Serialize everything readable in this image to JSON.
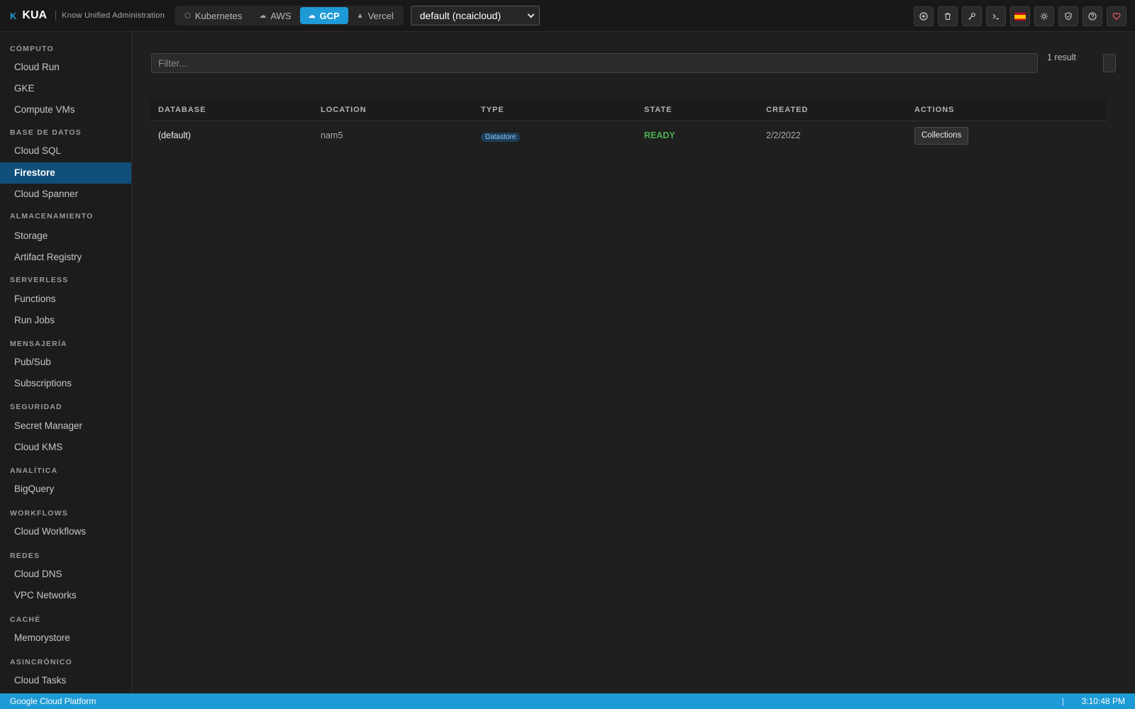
{
  "header": {
    "logo_mark": "K",
    "app_name": "KUA",
    "tagline": "Know Unified Administration",
    "providers": [
      {
        "label": "Kubernetes",
        "icon": "cube-icon",
        "active": false
      },
      {
        "label": "AWS",
        "icon": "cloud-icon",
        "active": false
      },
      {
        "label": "GCP",
        "icon": "cloud-sync-icon",
        "active": true
      },
      {
        "label": "Vercel",
        "icon": "triangle-icon",
        "active": false
      }
    ],
    "project_selected": "default (ncaicloud)",
    "tools": [
      "add-icon",
      "trash-icon",
      "key-icon",
      "terminal-icon",
      "spain-flag-icon",
      "sun-icon",
      "shield-icon",
      "help-icon",
      "heart-icon"
    ]
  },
  "sidebar": {
    "sections": [
      {
        "title": "CÓMPUTO",
        "items": [
          "Cloud Run",
          "GKE",
          "Compute VMs"
        ]
      },
      {
        "title": "BASE DE DATOS",
        "items": [
          "Cloud SQL",
          "Firestore",
          "Cloud Spanner"
        ]
      },
      {
        "title": "ALMACENAMIENTO",
        "items": [
          "Storage",
          "Artifact Registry"
        ]
      },
      {
        "title": "SERVERLESS",
        "items": [
          "Functions",
          "Run Jobs"
        ]
      },
      {
        "title": "MENSAJERÍA",
        "items": [
          "Pub/Sub",
          "Subscriptions"
        ]
      },
      {
        "title": "SEGURIDAD",
        "items": [
          "Secret Manager",
          "Cloud KMS"
        ]
      },
      {
        "title": "ANALÍTICA",
        "items": [
          "BigQuery"
        ]
      },
      {
        "title": "WORKFLOWS",
        "items": [
          "Cloud Workflows"
        ]
      },
      {
        "title": "REDES",
        "items": [
          "Cloud DNS",
          "VPC Networks"
        ]
      },
      {
        "title": "CACHÉ",
        "items": [
          "Memorystore"
        ]
      },
      {
        "title": "ASINCRÓNICO",
        "items": [
          "Cloud Tasks"
        ]
      }
    ],
    "active_item": "Firestore"
  },
  "main": {
    "filter_placeholder": "Filter...",
    "result_count": "1 result",
    "table": {
      "columns": [
        "DATABASE",
        "LOCATION",
        "TYPE",
        "STATE",
        "CREATED",
        "ACTIONS"
      ],
      "rows": [
        {
          "database": "(default)",
          "location": "nam5",
          "type": "Datastore",
          "state": "READY",
          "created": "2/2/2022",
          "action": "Collections"
        }
      ]
    }
  },
  "statusbar": {
    "platform": "Google Cloud Platform",
    "separator": "|",
    "time": "3:10:48 PM"
  },
  "colors": {
    "accent": "#1e9bd7",
    "active_nav": "#0f4f7a",
    "ready": "#4caf50",
    "background": "#1f1f1f"
  }
}
